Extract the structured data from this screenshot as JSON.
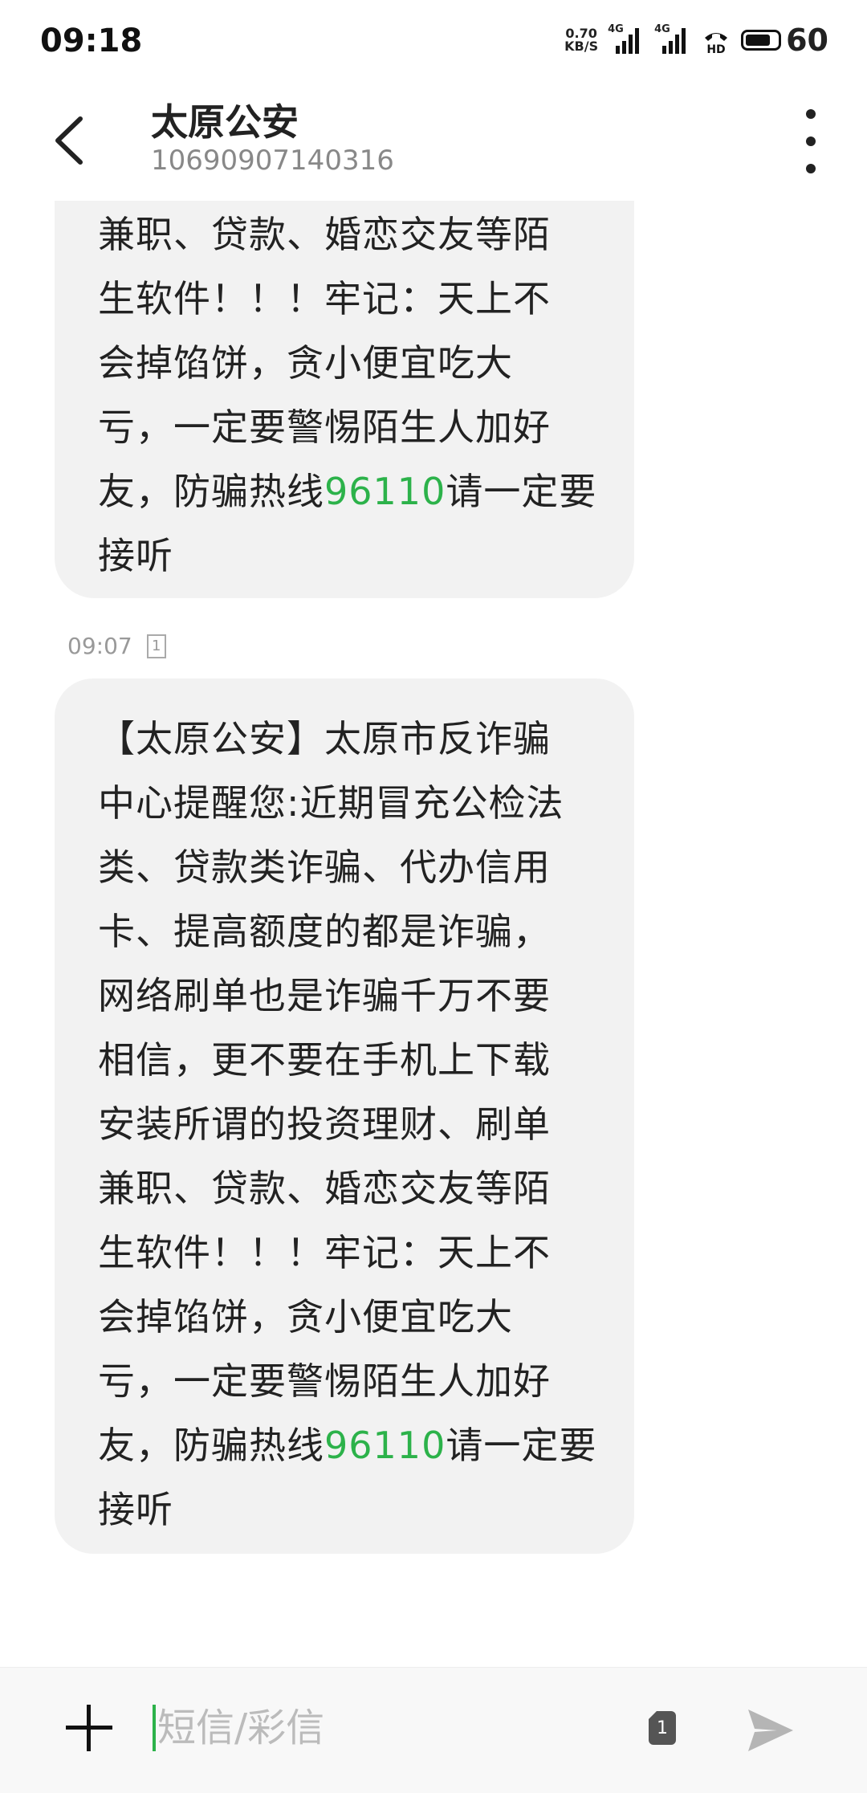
{
  "status_bar": {
    "time": "09:18",
    "net_speed_value": "0.70",
    "net_speed_unit": "KB/S",
    "signal1_label": "4G",
    "signal2_label": "4G",
    "hd_label": "HD",
    "battery_level": "60"
  },
  "header": {
    "contact_name": "太原公安",
    "contact_number": "10690907140316"
  },
  "messages": [
    {
      "lines": [
        "兼职、贷款、婚恋交友等陌",
        "生软件！！！牢记：天上不",
        "会掉馅饼，贪小便宜吃大",
        "亏，一定要警惕陌生人加好"
      ],
      "hotline_prefix": "友，防骗热线",
      "hotline": "96110",
      "hotline_suffix": "请一定要",
      "last_line": "接听"
    },
    {
      "time": "09:07",
      "sim": "1",
      "lines": [
        "【太原公安】太原市反诈骗",
        "中心提醒您:近期冒充公检法",
        "类、贷款类诈骗、代办信用",
        "卡、提高额度的都是诈骗，",
        "网络刷单也是诈骗千万不要",
        "相信，更不要在手机上下载",
        "安装所谓的投资理财、刷单",
        "兼职、贷款、婚恋交友等陌",
        "生软件！！！牢记：天上不",
        "会掉馅饼，贪小便宜吃大",
        "亏，一定要警惕陌生人加好"
      ],
      "hotline_prefix": "友，防骗热线",
      "hotline": "96110",
      "hotline_suffix": "请一定要",
      "last_line": "接听"
    }
  ],
  "input_bar": {
    "placeholder": "短信/彩信",
    "sim": "1"
  },
  "colors": {
    "accent": "#2cb24a",
    "bubble": "#f2f2f2"
  },
  "icons": [
    "back-arrow-icon",
    "more-vert-icon",
    "plus-icon",
    "sim-icon",
    "send-icon"
  ]
}
